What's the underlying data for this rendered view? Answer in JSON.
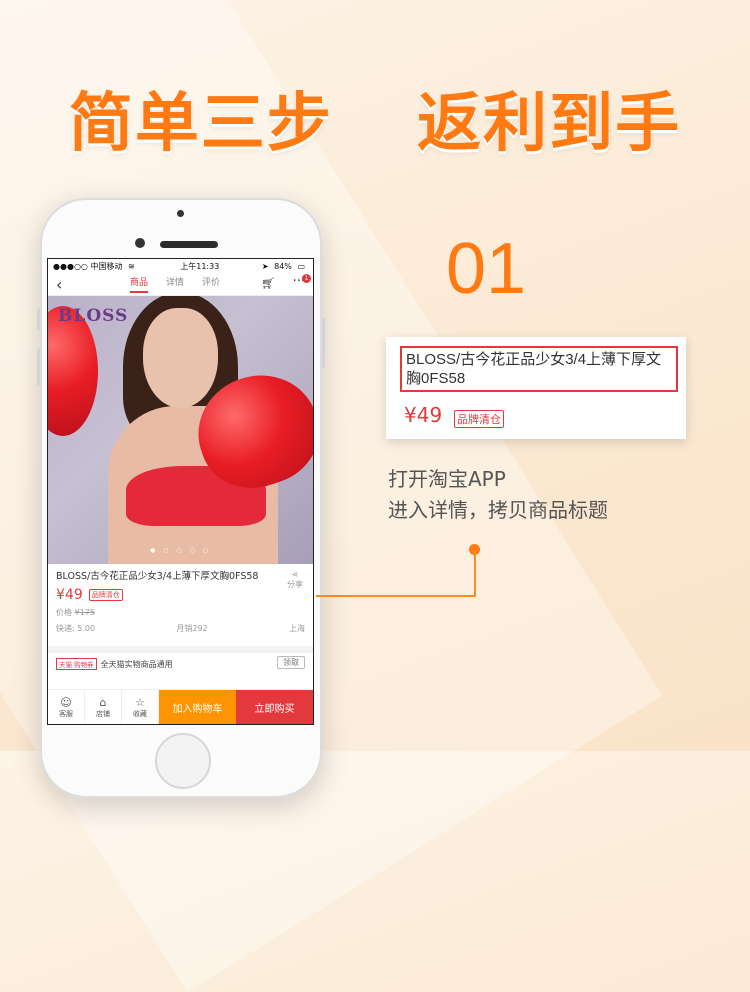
{
  "headline": {
    "left": "简单三步",
    "right": "返利到手"
  },
  "phone": {
    "status": {
      "carrier": "●●●○○ 中国移动",
      "wifi": "WiFi",
      "time": "上午11:33",
      "battery": "84%"
    },
    "nav": {
      "tabs": [
        "商品",
        "详情",
        "评价"
      ],
      "active_tab": "商品",
      "cart_badge": "1"
    },
    "product": {
      "brand_logo": "BLOSS",
      "title": "BLOSS/古今花正品少女3/4上薄下厚文胸0FS58",
      "share_label": "分享",
      "price": "¥49",
      "tag": "品牌清仓",
      "orig_label": "价格",
      "orig_price": "¥175",
      "shipping": "快递: 5.00",
      "monthly_sales": "月销292",
      "location": "上海"
    },
    "coupon": {
      "tag": "天猫 购物券",
      "text": "全天猫实物商品通用",
      "claim": "领取"
    },
    "action_bar": {
      "service": "客服",
      "store": "店铺",
      "favorite": "收藏",
      "add_cart": "加入购物车",
      "buy_now": "立即购买"
    }
  },
  "step": {
    "number": "01",
    "card_title": "BLOSS/古今花正品少女3/4上薄下厚文胸0FS58",
    "card_price": "¥49",
    "card_tag": "品牌清仓",
    "instruction_line1": "打开淘宝APP",
    "instruction_line2": "进入详情，拷贝商品标题"
  },
  "colors": {
    "accent": "#ff7a12",
    "price_red": "#e4393c",
    "cart_orange": "#ff9402"
  }
}
